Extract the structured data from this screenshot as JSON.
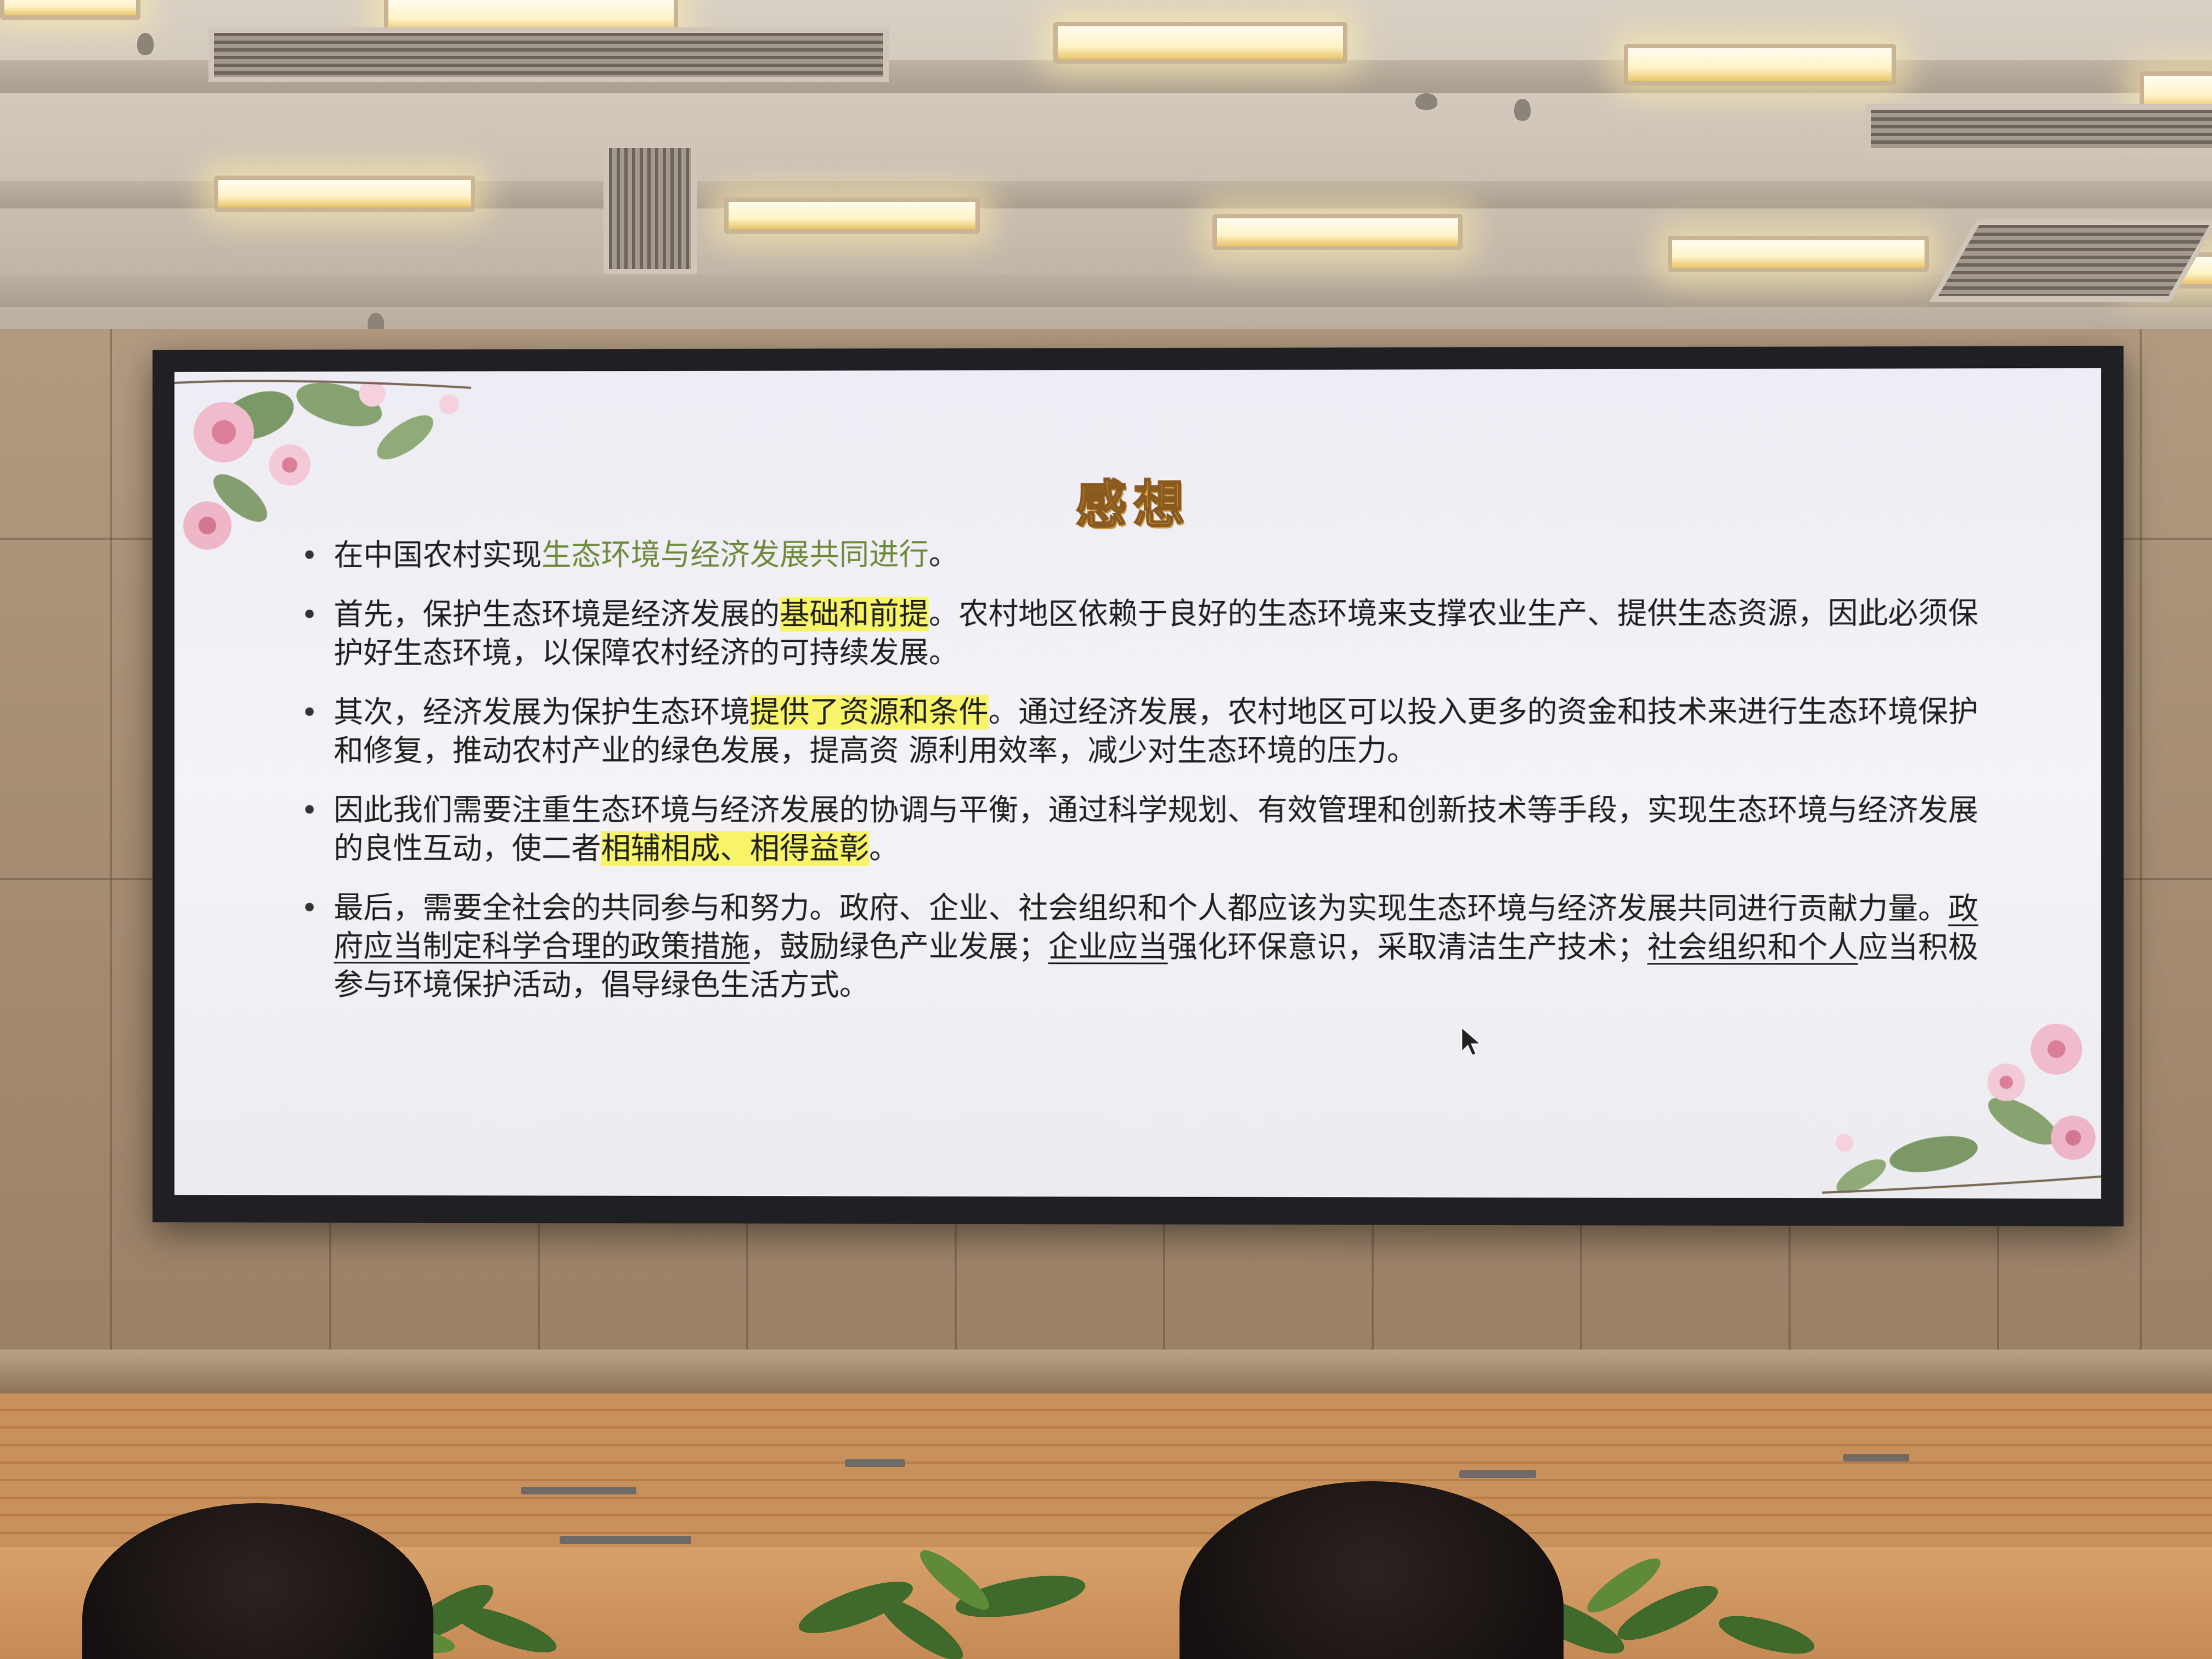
{
  "slide": {
    "title": "感想",
    "bullets": [
      {
        "segments": [
          {
            "text": "在中国农村实现",
            "style": "plain"
          },
          {
            "text": "生态环境与经济发展共同进行",
            "style": "green"
          },
          {
            "text": "。",
            "style": "plain"
          }
        ]
      },
      {
        "segments": [
          {
            "text": "首先，保护生态环境是经济发展的",
            "style": "plain"
          },
          {
            "text": "基础和前提",
            "style": "highlight"
          },
          {
            "text": "。农村地区依赖于良好的生态环境来支撑农业生产、提供生态资源，因此必须保护好生态环境，以保障农村经济的可持续发展。",
            "style": "plain"
          }
        ]
      },
      {
        "segments": [
          {
            "text": "其次，经济发展为保护生态环境",
            "style": "plain"
          },
          {
            "text": "提供了资源和条件",
            "style": "highlight"
          },
          {
            "text": "。通过经济发展，农村地区可以投入更多的资金和技术来进行生态环境保护和修复，推动农村产业的绿色发展，提高资 源利用效率，减少对生态环境的压力。",
            "style": "plain"
          }
        ]
      },
      {
        "segments": [
          {
            "text": "因此我们需要注重生态环境与经济发展的协调与平衡，通过科学规划、有效管理和创新技术等手段，实现生态环境与经济发展的良性互动，使二者",
            "style": "plain"
          },
          {
            "text": "相辅相成、相得益彰",
            "style": "highlight"
          },
          {
            "text": "。",
            "style": "plain"
          }
        ]
      },
      {
        "segments": [
          {
            "text": "最后，需要全社会的共同参与和努力。政府、企业、社会组织和个人都应该为实现生态环境与经济发展共同进行贡献力量。",
            "style": "plain"
          },
          {
            "text": "政府应当制定科学合理的政策措施",
            "style": "underline"
          },
          {
            "text": "，鼓励绿色产业发展；",
            "style": "plain"
          },
          {
            "text": "企业应当",
            "style": "underline"
          },
          {
            "text": "强化环保意识，采取清洁生产技术；",
            "style": "plain"
          },
          {
            "text": "社会组织和个人",
            "style": "underline"
          },
          {
            "text": "应当积极参与环境保护活动，倡导绿色生活方式。",
            "style": "plain"
          }
        ]
      }
    ]
  },
  "colors": {
    "title": "#e7b24a",
    "green_text": "#6e8a3a",
    "highlight": "#f7f46a",
    "body_text": "#202020"
  },
  "icons": {
    "decor_top_left": "pink-flowers-icon",
    "decor_bottom_right": "pink-flowers-icon",
    "cursor": "mouse-cursor-icon"
  }
}
